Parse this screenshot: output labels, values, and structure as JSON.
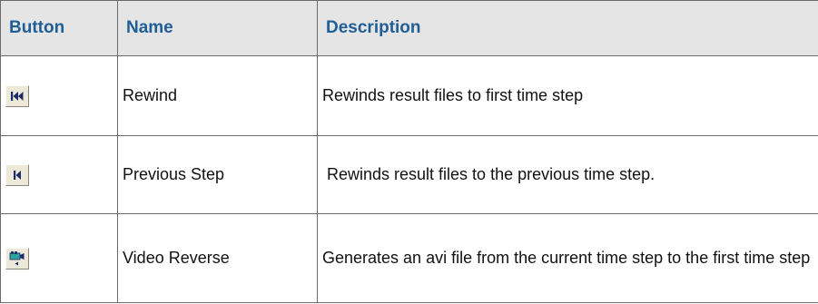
{
  "table": {
    "headers": {
      "button": "Button",
      "name": "Name",
      "description": "Description"
    },
    "rows": [
      {
        "icon": "rewind-icon",
        "name": "Rewind",
        "description": "Rewinds result files to first time step"
      },
      {
        "icon": "previous-step-icon",
        "name": "Previous Step",
        "description": " Rewinds result files to the previous time step."
      },
      {
        "icon": "video-reverse-icon",
        "name": "Video Reverse",
        "description": "Generates an avi file from the current time step to the first time step"
      }
    ]
  },
  "colors": {
    "header_text": "#1f5e96",
    "header_background": "#e5e5e5",
    "border": "#6b6b6b",
    "button_face": "#ece9d8",
    "icon_dark": "#1a2a6b",
    "icon_teal": "#2fa39a"
  }
}
